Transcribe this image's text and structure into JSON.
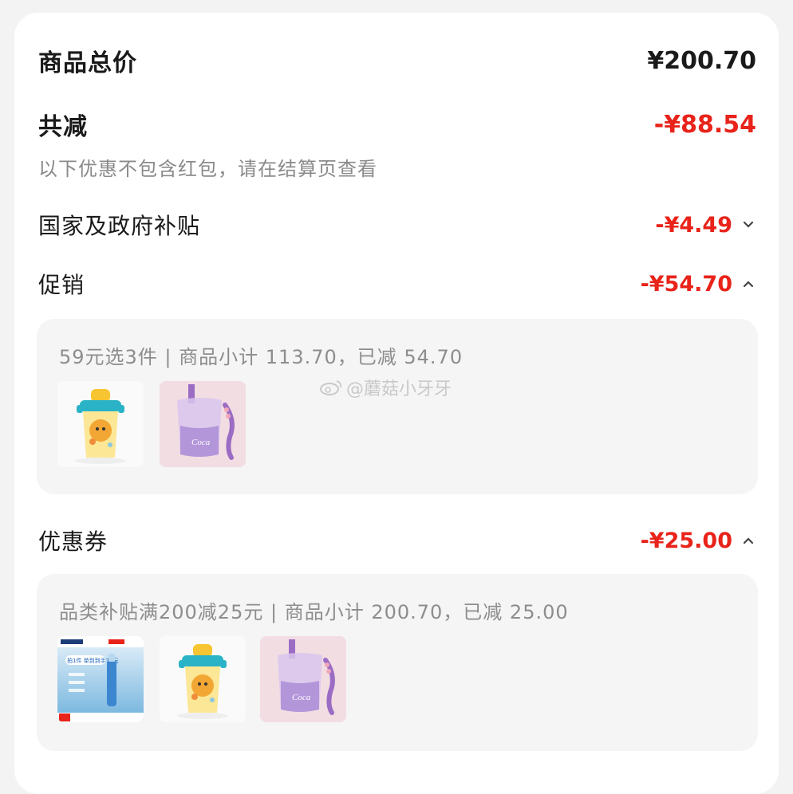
{
  "summary": {
    "total_label": "商品总价",
    "total_value": "¥200.70",
    "discount_label": "共减",
    "discount_value": "-¥88.54",
    "note": "以下优惠不包含红包，请在结算页查看"
  },
  "sections": [
    {
      "label": "国家及政府补贴",
      "value": "-¥4.49",
      "expanded": false
    },
    {
      "label": "促销",
      "value": "-¥54.70",
      "expanded": true
    },
    {
      "label": "优惠券",
      "value": "-¥25.00",
      "expanded": true
    }
  ],
  "promotion_panel": {
    "text": "59元选3件 | 商品小计 113.70，已减 54.70",
    "items": [
      "yellow-kettle",
      "purple-cup"
    ]
  },
  "coupon_panel": {
    "text": "品类补贴满200减25元 | 商品小计 200.70，已减 25.00",
    "items": [
      "blue-bottle-ad",
      "yellow-kettle",
      "purple-cup"
    ],
    "ad_text": "拍1件 单到到手75元"
  },
  "watermark": "@蘑菇小牙牙",
  "colors": {
    "accent_red": "#e8231a",
    "muted": "#8d8d8d",
    "panel_bg": "#f5f5f5"
  }
}
